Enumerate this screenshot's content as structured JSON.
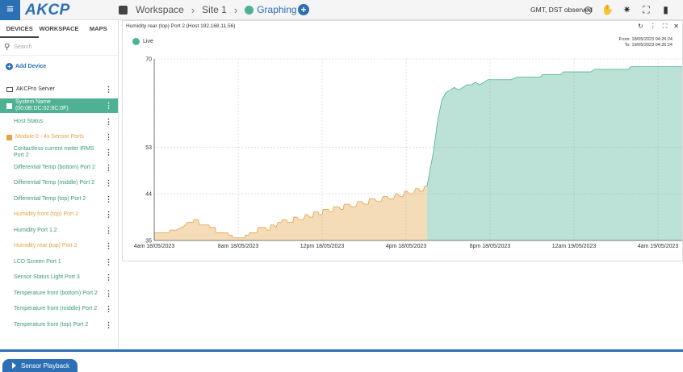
{
  "app": {
    "logo": "AKCP",
    "breadcrumb": [
      "Workspace",
      "Site 1",
      "Graphing"
    ],
    "timezone": "GMT, DST observed"
  },
  "sidebar": {
    "tabs": [
      "DEVICES",
      "WORKSPACE",
      "MAPS"
    ],
    "search_placeholder": "Search",
    "add_device": "Add Device",
    "items": [
      {
        "label": "AKCPro Server",
        "style": "dark",
        "icon": "monitor-icon"
      },
      {
        "label": "System Name (00:0B:DC:02:8C:0F)",
        "style": "selected",
        "icon": "server-icon"
      },
      {
        "label": "Host Status",
        "style": "green"
      },
      {
        "label": "Module 0 - 4x Sensor Ports",
        "style": "orange",
        "icon": "module-icon"
      },
      {
        "label": "Contactless current meter IRMS Port 2",
        "style": "green"
      },
      {
        "label": "Differential Temp (bottom) Port 2",
        "style": "green"
      },
      {
        "label": "Differential Temp (middle) Port 2",
        "style": "green"
      },
      {
        "label": "Differential Temp (top) Port 2",
        "style": "green"
      },
      {
        "label": "Humidity front (top) Port 2",
        "style": "orange"
      },
      {
        "label": "Humidity Port 1.2",
        "style": "green"
      },
      {
        "label": "Humidity rear (top) Port 2",
        "style": "orange"
      },
      {
        "label": "LCD Screen Port 1",
        "style": "green"
      },
      {
        "label": "Sensor Status Light Port 3",
        "style": "green"
      },
      {
        "label": "Temperature front (bottom) Port 2",
        "style": "green"
      },
      {
        "label": "Temperature front (middle) Port 2",
        "style": "green"
      },
      {
        "label": "Temperature front (top) Port 2",
        "style": "green"
      }
    ],
    "playback": "Sensor Playback"
  },
  "panel": {
    "title": "Humidity rear (top) Port 2 (Host 192.168.11.56)",
    "live_label": "Live",
    "from": "From: 18/05/2023 04:26:24",
    "to": "To: 19/05/2023 04:26:24"
  },
  "colors": {
    "accent": "#2d6fb4",
    "normal": "#4fb193",
    "warning": "#e5a244"
  },
  "chart_data": {
    "type": "area",
    "ylim": [
      35,
      70
    ],
    "yticks": [
      35,
      44,
      53,
      70
    ],
    "xticks": [
      "4am 18/05/2023",
      "8am 18/05/2023",
      "12pm 18/05/2023",
      "4pm 18/05/2023",
      "8pm 18/05/2023",
      "12am 19/05/2023",
      "4am 19/05/2023"
    ],
    "xlim_hours": [
      0,
      24
    ],
    "series": [
      {
        "status": "warning",
        "color": "#e5a244",
        "x": [
          0,
          0.7,
          0.75,
          1.05,
          1.3,
          1.35,
          1.6,
          1.65,
          1.85,
          1.9,
          2.1,
          2.15,
          2.6,
          2.65,
          2.9,
          2.95,
          3.5,
          3.55,
          3.7,
          3.75,
          4.0,
          4.3,
          4.35,
          4.5,
          4.55,
          4.9,
          4.95,
          5.3,
          5.35,
          5.5,
          5.55,
          5.7,
          5.8,
          5.9,
          6.05,
          6.1,
          6.3,
          6.35,
          6.6,
          6.65,
          6.8,
          6.9,
          7.1,
          7.2,
          7.3,
          7.4,
          7.55,
          7.6,
          7.8,
          7.85,
          8.0,
          8.05,
          8.3,
          8.35,
          8.5,
          8.55,
          8.8,
          8.9,
          9.0,
          9.05,
          9.3,
          9.4,
          9.6,
          9.7,
          9.9,
          10.0,
          10.2,
          10.25,
          10.5,
          10.6,
          10.8,
          10.9,
          11.1,
          11.2,
          11.4,
          11.5,
          11.6,
          11.7,
          11.85,
          11.95,
          12.05,
          12.15,
          12.35,
          12.45,
          12.6,
          12.65,
          12.8,
          12.9,
          13.0
        ],
        "y": [
          36.5,
          36.5,
          37.0,
          37.0,
          37.5,
          37.5,
          38.5,
          38.5,
          38.5,
          39.0,
          39.0,
          38.0,
          38.0,
          37.5,
          37.5,
          36.5,
          36.5,
          36.0,
          36.0,
          35.5,
          35.5,
          35.5,
          36.0,
          36.0,
          36.5,
          36.5,
          37.5,
          37.5,
          37.0,
          37.0,
          38.0,
          38.0,
          37.5,
          38.5,
          38.5,
          39.0,
          39.0,
          38.5,
          38.5,
          39.5,
          39.5,
          39.0,
          39.0,
          40.0,
          40.0,
          39.5,
          39.5,
          40.5,
          40.5,
          40.0,
          40.0,
          41.0,
          41.0,
          40.5,
          40.5,
          41.5,
          41.5,
          41.0,
          41.0,
          42.0,
          42.0,
          41.5,
          41.5,
          42.5,
          42.5,
          42.0,
          42.0,
          43.0,
          43.0,
          42.5,
          42.5,
          43.5,
          43.5,
          43.0,
          43.0,
          44.0,
          44.0,
          43.5,
          43.5,
          44.5,
          44.5,
          44.0,
          44.0,
          45.0,
          45.0,
          44.5,
          44.5,
          45.5,
          45.5
        ]
      },
      {
        "status": "normal",
        "color": "#4fb193",
        "x": [
          13.0,
          13.3,
          13.5,
          13.7,
          13.9,
          14.1,
          14.3,
          14.5,
          14.7,
          14.9,
          15.1,
          15.3,
          15.5,
          15.7,
          15.9,
          16.1,
          16.5,
          17.0,
          17.3,
          17.5,
          18.0,
          18.4,
          18.5,
          19.0,
          19.4,
          19.5,
          20.0,
          20.5,
          20.8,
          21.0,
          21.4,
          21.5,
          22.0,
          22.3,
          22.5,
          22.6,
          22.7,
          22.8,
          23.0,
          23.3,
          23.6,
          24.0,
          24.6,
          25.0,
          25.5,
          26.0,
          26.4,
          26.6,
          26.8,
          27.0,
          27.4,
          27.6,
          27.8,
          28.0
        ],
        "y": [
          45.5,
          52.0,
          58.0,
          62.0,
          63.5,
          64.0,
          64.5,
          64.0,
          64.5,
          65.0,
          65.0,
          65.5,
          65.0,
          65.5,
          66.0,
          66.0,
          66.0,
          66.0,
          66.5,
          66.5,
          66.5,
          66.5,
          67.0,
          67.0,
          67.0,
          67.5,
          67.5,
          67.5,
          67.5,
          68.0,
          68.0,
          68.0,
          68.0,
          68.0,
          68.0,
          68.0,
          68.5,
          68.5,
          68.5,
          68.5,
          68.5,
          68.5,
          68.5,
          68.5,
          68.5,
          68.5,
          68.5,
          68.5,
          68.5,
          68.5,
          68.5,
          68.5,
          68.5,
          68.5
        ]
      }
    ]
  }
}
